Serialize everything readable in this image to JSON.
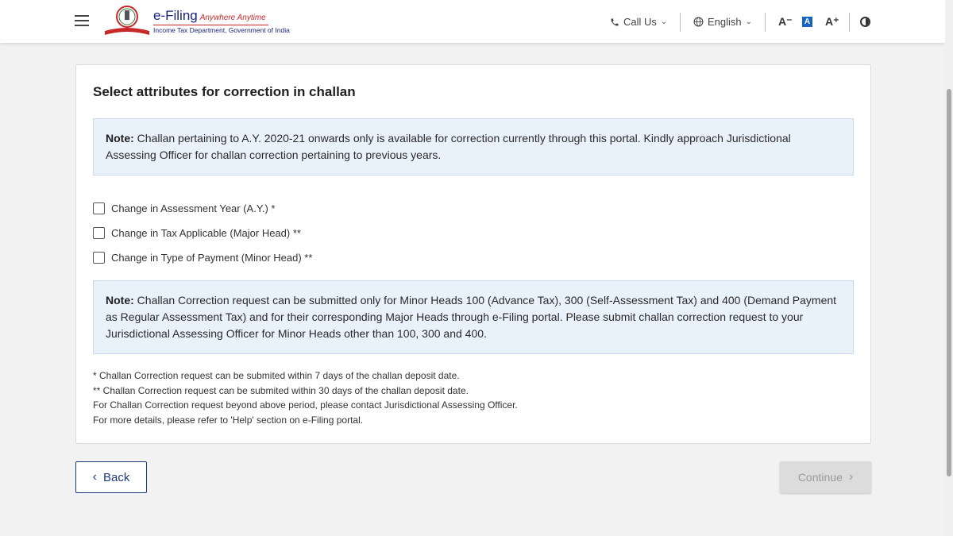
{
  "header": {
    "brand_title": "e-Filing",
    "brand_tagline": "Anywhere Anytime",
    "brand_subtitle": "Income Tax Department, Government of India",
    "call_us": "Call Us",
    "language": "English",
    "font_decrease": "A⁻",
    "font_normal": "A",
    "font_increase": "A⁺"
  },
  "main": {
    "title": "Select attributes for correction in challan",
    "note1": {
      "label": "Note:",
      "text": " Challan pertaining to A.Y. 2020-21 onwards only is available for correction currently through this portal. Kindly approach Jurisdictional Assessing Officer for challan correction pertaining to previous years."
    },
    "checkboxes": [
      {
        "label": "Change in Assessment Year (A.Y.) *",
        "checked": false
      },
      {
        "label": "Change in Tax Applicable (Major Head) **",
        "checked": false
      },
      {
        "label": "Change in Type of Payment (Minor Head) **",
        "checked": false
      }
    ],
    "note2": {
      "label": "Note:",
      "text": " Challan Correction request can be submitted only for Minor Heads 100 (Advance Tax), 300 (Self-Assessment Tax) and 400 (Demand Payment as Regular Assessment Tax) and for their corresponding Major Heads through e-Filing portal. Please submit challan correction request to your Jurisdictional Assessing Officer for Minor Heads other than 100, 300 and 400."
    },
    "footnotes": [
      "* Challan Correction request can be submited within 7 days of the challan deposit date.",
      "** Challan Correction request can be submited within 30 days of the challan deposit date.",
      "For Challan Correction request beyond above period, please contact Jurisdictional Assessing Officer.",
      "For more details, please refer to 'Help' section on e-Filing portal."
    ]
  },
  "actions": {
    "back": "Back",
    "continue": "Continue"
  },
  "colors": {
    "primary": "#1a3a7a",
    "note_bg": "#e9f1fb",
    "disabled_bg": "#dcdcdc"
  }
}
